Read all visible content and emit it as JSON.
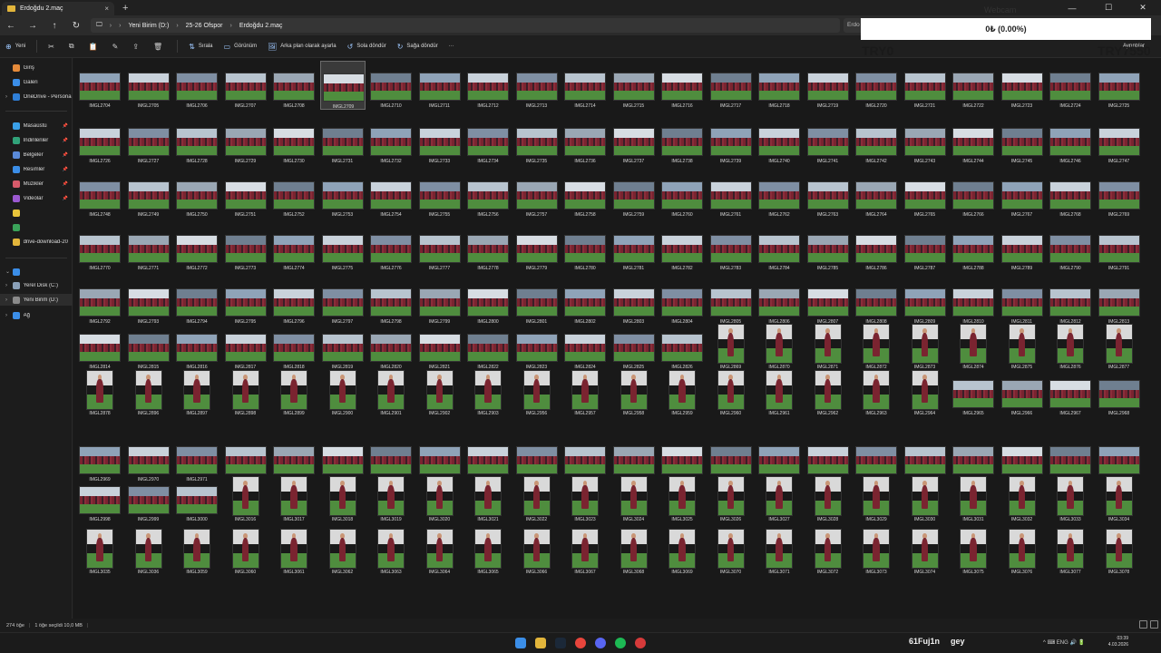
{
  "window": {
    "tab_title": "Erdoğdu 2.maç",
    "tab_close": "×",
    "new_tab": "+",
    "controls": [
      "—",
      "☐",
      "✕"
    ]
  },
  "address": {
    "nav": [
      "←",
      "→",
      "↑",
      "↻"
    ],
    "crumbs": [
      "Yeni Birim (D:)",
      "25-26 Ofspor",
      "Erdoğdu 2.maç"
    ],
    "search_placeholder": "Erdo"
  },
  "commands": [
    {
      "label": "Yeni",
      "icon": "plus-icon"
    },
    {
      "label": "",
      "icon": "cut-icon"
    },
    {
      "label": "",
      "icon": "copy-icon"
    },
    {
      "label": "",
      "icon": "paste-icon"
    },
    {
      "label": "",
      "icon": "rename-icon"
    },
    {
      "label": "",
      "icon": "share-icon"
    },
    {
      "label": "",
      "icon": "delete-icon"
    },
    {
      "label": "Sırala",
      "icon": "sort-icon"
    },
    {
      "label": "Görünüm",
      "icon": "view-icon"
    },
    {
      "label": "Arka plan olarak ayarla",
      "icon": "wallpaper-icon"
    },
    {
      "label": "Sola döndür",
      "icon": "rotate-left-icon"
    },
    {
      "label": "Sağa döndür",
      "icon": "rotate-right-icon"
    },
    {
      "label": "···",
      "icon": "more-icon"
    }
  ],
  "details_label": "Ayrıntılar",
  "sidebar": {
    "items": [
      {
        "label": "Giriş",
        "icon": "home-icon",
        "color": "#e58a3a",
        "chev": "",
        "pin": ""
      },
      {
        "label": "Galeri",
        "icon": "gallery-icon",
        "color": "#3b8ee8",
        "chev": "",
        "pin": ""
      },
      {
        "label": "OneDrive - Persona",
        "icon": "onedrive-icon",
        "color": "#2f7fd8",
        "chev": "›",
        "pin": ""
      },
      {
        "label": "Masaüstü",
        "icon": "desktop-icon",
        "color": "#3aa0e8",
        "chev": "",
        "pin": "📌"
      },
      {
        "label": "İndirilenler",
        "icon": "downloads-icon",
        "color": "#31a37a",
        "chev": "",
        "pin": "📌"
      },
      {
        "label": "Belgeler",
        "icon": "documents-icon",
        "color": "#5a8ad8",
        "chev": "",
        "pin": "📌"
      },
      {
        "label": "Resimler",
        "icon": "pictures-icon",
        "color": "#3b8ee8",
        "chev": "",
        "pin": "📌"
      },
      {
        "label": "Müzikler",
        "icon": "music-icon",
        "color": "#d65a6a",
        "chev": "",
        "pin": "📌"
      },
      {
        "label": "Videolar",
        "icon": "videos-icon",
        "color": "#9b59d0",
        "chev": "",
        "pin": "📌"
      },
      {
        "label": "",
        "icon": "star-icon",
        "color": "#e8c43a",
        "chev": "",
        "pin": ""
      },
      {
        "label": "",
        "icon": "arrow-icon",
        "color": "#3aa35a",
        "chev": "",
        "pin": ""
      },
      {
        "label": "drive-download-20",
        "icon": "folder-icon",
        "color": "#e2b53b",
        "chev": "",
        "pin": ""
      },
      {
        "label": "",
        "icon": "this-pc-icon",
        "color": "#3b8ee8",
        "chev": "⌄",
        "pin": ""
      },
      {
        "label": "Yerel Disk (C:)",
        "icon": "drive-icon",
        "color": "#8aa0b8",
        "chev": "›",
        "pin": ""
      },
      {
        "label": "Yeni Birim (D:)",
        "icon": "drive-icon",
        "color": "#8a8a8a",
        "chev": "›",
        "pin": ""
      },
      {
        "label": "Ağ",
        "icon": "network-icon",
        "color": "#3b8ee8",
        "chev": "›",
        "pin": ""
      }
    ]
  },
  "files": {
    "rows": [
      [
        "IMGL2704",
        "IMGL2705",
        "IMGL2706",
        "IMGL2707",
        "IMGL2708",
        "IMGL2709",
        "IMGL2710",
        "IMGL2711",
        "IMGL2712",
        "IMGL2713",
        "IMGL2714",
        "IMGL2715",
        "IMGL2716",
        "IMGL2717",
        "IMGL2718",
        "IMGL2719",
        "IMGL2720",
        "IMGL2721",
        "IMGL2722",
        "IMGL2723",
        "IMGL2724",
        "IMGL2725"
      ],
      [
        "IMGL2726",
        "IMGL2727",
        "IMGL2728",
        "IMGL2729",
        "IMGL2730",
        "IMGL2731",
        "IMGL2732",
        "IMGL2733",
        "IMGL2734",
        "IMGL2735",
        "IMGL2736",
        "IMGL2737",
        "IMGL2738",
        "IMGL2739",
        "IMGL2740",
        "IMGL2741",
        "IMGL2742",
        "IMGL2743",
        "IMGL2744",
        "IMGL2745",
        "IMGL2746",
        "IMGL2747"
      ],
      [
        "IMGL2748",
        "IMGL2749",
        "IMGL2750",
        "IMGL2751",
        "IMGL2752",
        "IMGL2753",
        "IMGL2754",
        "IMGL2755",
        "IMGL2756",
        "IMGL2757",
        "IMGL2758",
        "IMGL2759",
        "IMGL2760",
        "IMGL2761",
        "IMGL2762",
        "IMGL2763",
        "IMGL2764",
        "IMGL2765",
        "IMGL2766",
        "IMGL2767",
        "IMGL2768",
        "IMGL2769"
      ],
      [
        "IMGL2770",
        "IMGL2771",
        "IMGL2772",
        "IMGL2773",
        "IMGL2774",
        "IMGL2775",
        "IMGL2776",
        "IMGL2777",
        "IMGL2778",
        "IMGL2779",
        "IMGL2780",
        "IMGL2781",
        "IMGL2782",
        "IMGL2783",
        "IMGL2784",
        "IMGL2785",
        "IMGL2786",
        "IMGL2787",
        "IMGL2788",
        "IMGL2789",
        "IMGL2790",
        "IMGL2791"
      ],
      [
        "IMGL2792",
        "IMGL2793",
        "IMGL2794",
        "IMGL2795",
        "IMGL2796",
        "IMGL2797",
        "IMGL2798",
        "IMGL2799",
        "IMGL2800",
        "IMGL2801",
        "IMGL2802",
        "IMGL2803",
        "IMGL2804",
        "IMGL2805",
        "IMGL2806",
        "IMGL2807",
        "IMGL2808",
        "IMGL2809",
        "IMGL2810",
        "IMGL2811",
        "IMGL2812",
        "IMGL2813"
      ],
      [
        "IMGL2814",
        "IMGL2815",
        "IMGL2816",
        "IMGL2817",
        "IMGL2818",
        "IMGL2819",
        "IMGL2820",
        "IMGL2821",
        "IMGL2822",
        "IMGL2823",
        "IMGL2824",
        "IMGL2825",
        "IMGL2826",
        "IMGL2869",
        "IMGL2870",
        "IMGL2871",
        "IMGL2872",
        "IMGL2873",
        "IMGL2874",
        "IMGL2875",
        "IMGL2876",
        "IMGL2877"
      ],
      [
        "IMGL2878",
        "IMGL2896",
        "IMGL2897",
        "IMGL2898",
        "IMGL2899",
        "IMGL2900",
        "IMGL2901",
        "IMGL2902",
        "IMGL2903",
        "IMGL2956",
        "IMGL2957",
        "IMGL2958",
        "IMGL2959",
        "IMGL2960",
        "IMGL2961",
        "IMGL2962",
        "IMGL2963",
        "IMGL2964",
        "IMGL2965",
        "IMGL2966",
        "IMGL2967",
        "IMGL2968"
      ],
      [
        "IMGL2969",
        "IMGL2970",
        "IMGL2971",
        "IMGL2972",
        "IMGL2973",
        "IMGL2974",
        "IMGL2975",
        "IMGL2976",
        "IMGL2977",
        "IMGL2978",
        "IMGL2979",
        "IMGL2980",
        "IMGL2987",
        "IMGL2988",
        "IMGL2989",
        "IMGL2990",
        "IMGL2992",
        "IMGL2993",
        "IMGL2994",
        "IMGL2995",
        "IMGL2996",
        "IMGL2997"
      ],
      [
        "IMGL2998",
        "IMGL2999",
        "IMGL3000",
        "IMGL3016",
        "IMGL3017",
        "IMGL3018",
        "IMGL3019",
        "IMGL3020",
        "IMGL3021",
        "IMGL3022",
        "IMGL3023",
        "IMGL3024",
        "IMGL3025",
        "IMGL3026",
        "IMGL3027",
        "IMGL3028",
        "IMGL3029",
        "IMGL3030",
        "IMGL3031",
        "IMGL3032",
        "IMGL3033",
        "IMGL3034"
      ],
      [
        "IMGL3035",
        "IMGL3036",
        "IMGL3059",
        "IMGL3060",
        "IMGL3061",
        "IMGL3062",
        "IMGL3063",
        "IMGL3064",
        "IMGL3065",
        "IMGL3066",
        "IMGL3067",
        "IMGL3068",
        "IMGL3069",
        "IMGL3070",
        "IMGL3071",
        "IMGL3072",
        "IMGL3073",
        "IMGL3074",
        "IMGL3075",
        "IMGL3076",
        "IMGL3077",
        "IMGL3078"
      ]
    ],
    "selected": "IMGL2709"
  },
  "status": {
    "count": "274 öğe",
    "selection": "1 öğe seçildi  10,0 MB"
  },
  "taskbar": {
    "icons": [
      {
        "name": "start-icon",
        "color": "#3b8ee8"
      },
      {
        "name": "file-explorer-icon",
        "color": "#e2b53b"
      },
      {
        "name": "steam-icon",
        "color": "#1b2838"
      },
      {
        "name": "chrome-icon",
        "color": "#e8453c"
      },
      {
        "name": "discord-icon",
        "color": "#5865f2"
      },
      {
        "name": "spotify-icon",
        "color": "#1db954"
      },
      {
        "name": "app-icon",
        "color": "#d63a3a"
      }
    ],
    "text": "61Fuj1n",
    "text2": "gey",
    "tray": "^  ⌨  ENG  🔊  🔋",
    "time": "03:39",
    "date": "4.03.2026"
  },
  "overlay": {
    "webcam_title": "Webcam",
    "balance": "0₺ (0.00%)",
    "try_left": "TRY0",
    "try_right": "TRY7550"
  }
}
